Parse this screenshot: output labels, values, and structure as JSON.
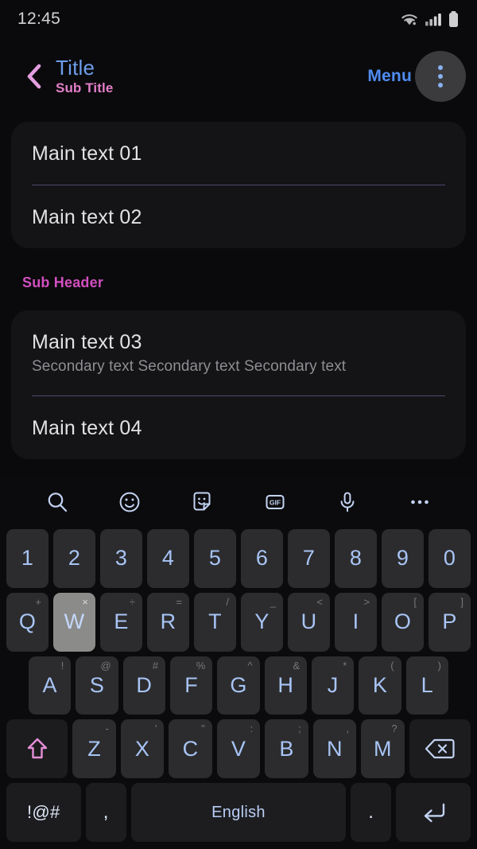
{
  "statusbar": {
    "time": "12:45",
    "icons": [
      "wifi-icon",
      "signal-icon",
      "battery-icon"
    ]
  },
  "appbar": {
    "back_icon": "chevron-left-icon",
    "title": "Title",
    "subtitle": "Sub Title",
    "menu_label": "Menu",
    "overflow_icon": "more-vertical-icon",
    "title_color": "#6d9eeb",
    "subtitle_color": "#e37fc9",
    "menu_color": "#4f8cf0",
    "back_color": "#e39fe0"
  },
  "content": {
    "card1": {
      "rows": [
        {
          "main": "Main text 01"
        },
        {
          "main": "Main text 02"
        }
      ]
    },
    "subheader": "Sub Header",
    "subheader_color": "#d24fc0",
    "card2": {
      "rows": [
        {
          "main": "Main text 03",
          "secondary": "Secondary text Secondary text Secondary text"
        },
        {
          "main": "Main text 04"
        }
      ]
    },
    "divider_color": "#4a4a6e"
  },
  "keyboard": {
    "toolbar": [
      {
        "name": "search-icon"
      },
      {
        "name": "emoji-icon"
      },
      {
        "name": "sticker-icon"
      },
      {
        "name": "gif-icon",
        "label": "GIF"
      },
      {
        "name": "microphone-icon"
      },
      {
        "name": "more-horizontal-icon"
      }
    ],
    "row_numbers": [
      {
        "label": "1"
      },
      {
        "label": "2"
      },
      {
        "label": "3"
      },
      {
        "label": "4"
      },
      {
        "label": "5"
      },
      {
        "label": "6"
      },
      {
        "label": "7"
      },
      {
        "label": "8"
      },
      {
        "label": "9"
      },
      {
        "label": "0"
      }
    ],
    "row_qwerty": [
      {
        "label": "Q",
        "sup": "+"
      },
      {
        "label": "W",
        "sup": "×",
        "pressed": true
      },
      {
        "label": "E",
        "sup": "÷"
      },
      {
        "label": "R",
        "sup": "="
      },
      {
        "label": "T",
        "sup": "/"
      },
      {
        "label": "Y",
        "sup": "_"
      },
      {
        "label": "U",
        "sup": "<"
      },
      {
        "label": "I",
        "sup": ">"
      },
      {
        "label": "O",
        "sup": "["
      },
      {
        "label": "P",
        "sup": "]"
      }
    ],
    "row_home": [
      {
        "label": "A",
        "sup": "!"
      },
      {
        "label": "S",
        "sup": "@"
      },
      {
        "label": "D",
        "sup": "#"
      },
      {
        "label": "F",
        "sup": "%"
      },
      {
        "label": "G",
        "sup": "^"
      },
      {
        "label": "H",
        "sup": "&"
      },
      {
        "label": "J",
        "sup": "*"
      },
      {
        "label": "K",
        "sup": "("
      },
      {
        "label": "L",
        "sup": ")"
      }
    ],
    "row_zxcv": [
      {
        "label": "Z",
        "sup": "-"
      },
      {
        "label": "X",
        "sup": "'"
      },
      {
        "label": "C",
        "sup": "\""
      },
      {
        "label": "V",
        "sup": ":"
      },
      {
        "label": "B",
        "sup": ";"
      },
      {
        "label": "N",
        "sup": ","
      },
      {
        "label": "M",
        "sup": "?"
      }
    ],
    "shift_icon": "shift-arrow-icon",
    "shift_color": "#e48fd8",
    "backspace_icon": "backspace-icon",
    "row_bottom": {
      "symbols_label": "!@#",
      "comma_label": ",",
      "space_label": "English",
      "period_label": ".",
      "enter_icon": "enter-icon"
    },
    "key_text_color": "#a8c4f5"
  }
}
